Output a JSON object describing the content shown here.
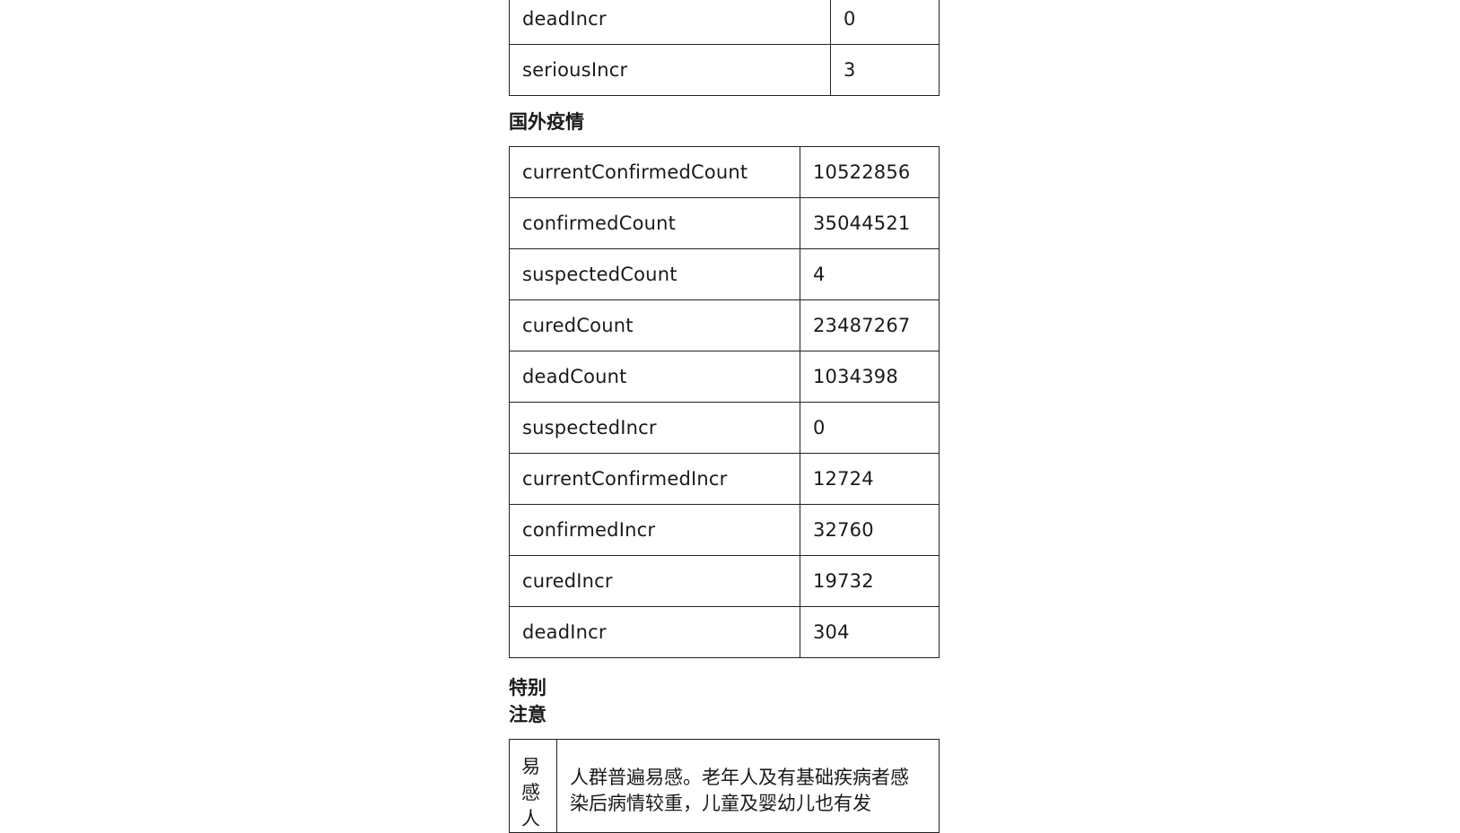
{
  "domestic_tail_rows": [
    {
      "key": "deadIncr",
      "value": "0"
    },
    {
      "key": "seriousIncr",
      "value": "3"
    }
  ],
  "foreign": {
    "heading": "国外疫情",
    "rows": [
      {
        "key": "currentConfirmedCount",
        "value": "10522856"
      },
      {
        "key": "confirmedCount",
        "value": "35044521"
      },
      {
        "key": "suspectedCount",
        "value": "4"
      },
      {
        "key": "curedCount",
        "value": "23487267"
      },
      {
        "key": "deadCount",
        "value": "1034398"
      },
      {
        "key": "suspectedIncr",
        "value": "0"
      },
      {
        "key": "currentConfirmedIncr",
        "value": "12724"
      },
      {
        "key": "confirmedIncr",
        "value": "32760"
      },
      {
        "key": "curedIncr",
        "value": "19732"
      },
      {
        "key": "deadIncr",
        "value": "304"
      }
    ]
  },
  "notice": {
    "heading": "特别注意",
    "rows": [
      {
        "term": "易感人",
        "text": "人群普遍易感。老年人及有基础疾病者感染后病情较重，儿童及婴幼儿也有发"
      }
    ]
  }
}
